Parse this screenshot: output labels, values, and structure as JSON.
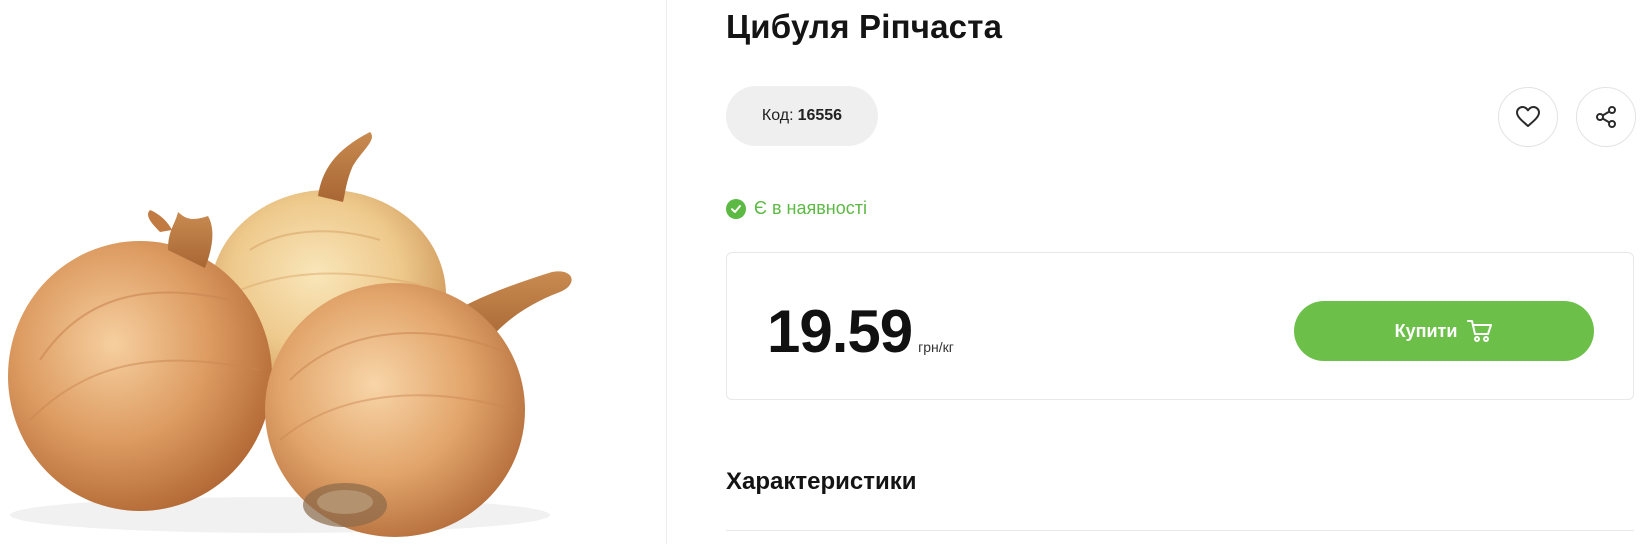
{
  "product": {
    "title": "Цибуля Ріпчаста",
    "code_label": "Код:",
    "code_value": "16556",
    "stock_text": "Є в наявності",
    "price": "19.59",
    "unit": "грн/кг",
    "buy_label": "Купити",
    "characteristics_title": "Характеристики",
    "image_subject": "onions-photo"
  },
  "colors": {
    "accent_green": "#6cc04a",
    "stock_green": "#5cb944",
    "pill_bg": "#efefef"
  },
  "icons": {
    "favorite": "heart-icon",
    "share": "share-icon",
    "cart": "cart-icon",
    "stock": "check-circle-icon"
  }
}
